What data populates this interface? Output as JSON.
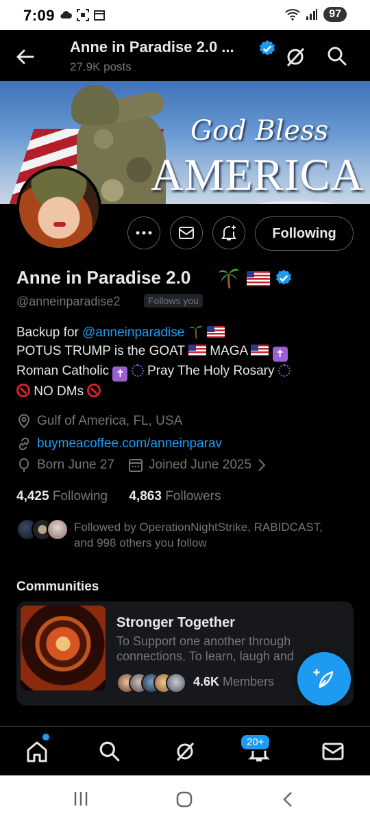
{
  "status_bar": {
    "time": "7:09",
    "battery": "97"
  },
  "header": {
    "title": "Anne in Paradise 2.0 ...",
    "posts": "27.9K posts"
  },
  "banner": {
    "line1": "God Bless",
    "line2": "AMERICA"
  },
  "actions": {
    "following_label": "Following"
  },
  "profile": {
    "name": "Anne in Paradise 2.0",
    "handle": "@anneinparadise2",
    "follows_you": "Follows you",
    "bio": {
      "line1_prefix": "Backup for ",
      "line1_link": "@anneinparadise",
      "line2_a": "POTUS TRUMP is the GOAT ",
      "line2_b": " MAGA ",
      "line3_a": "Roman Catholic ",
      "line3_b": " Pray The Holy Rosary ",
      "line4": " NO DMs "
    },
    "location": "Gulf of America, FL, USA",
    "website": "buymeacoffee.com/anneinparav",
    "born": "Born June 27",
    "joined": "Joined June 2025",
    "following_count": "4,425",
    "following_label": "Following",
    "followers_count": "4,863",
    "followers_label": "Followers",
    "followed_by_line1": "Followed by OperationNightStrike, RABIDCAST,",
    "followed_by_line2": "and 998 others you follow"
  },
  "communities": {
    "title": "Communities",
    "card": {
      "name": "Stronger Together",
      "description": "To Support one another through connections. To learn, laugh and",
      "members_count": "4.6K",
      "members_label": "Members"
    }
  },
  "bottom_nav": {
    "notif_badge": "20+"
  },
  "colors": {
    "accent": "#1d9bf0",
    "background": "#000000",
    "secondary_text": "#71767b"
  },
  "icons": [
    "back-arrow-icon",
    "verified-icon",
    "grok-icon",
    "search-icon",
    "more-icon",
    "message-icon",
    "bell-plus-icon",
    "location-icon",
    "link-icon",
    "balloon-icon",
    "calendar-icon",
    "compose-icon",
    "home-icon",
    "notifications-icon",
    "mail-icon"
  ]
}
